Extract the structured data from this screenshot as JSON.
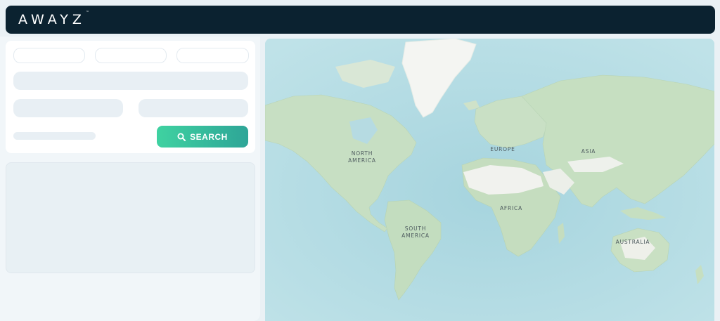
{
  "app": {
    "logo_text": "AWAYZ",
    "logo_mark": "™",
    "brand_dark": "#0b2230",
    "accent_gradient": [
      "#3fd2a1",
      "#2ea597"
    ]
  },
  "search_panel": {
    "search_button_label": "SEARCH",
    "search_button_icon": "magnifier"
  },
  "map": {
    "continent_labels": {
      "north_america": "NORTH\nAMERICA",
      "south_america": "SOUTH\nAMERICA",
      "europe": "EUROPE",
      "africa": "AFRICA",
      "asia": "ASIA",
      "australia": "AUSTRALIA"
    },
    "colors": {
      "ocean": "#aed7e0",
      "land": "#c7dfc3",
      "ice": "#f4f5f2"
    }
  }
}
